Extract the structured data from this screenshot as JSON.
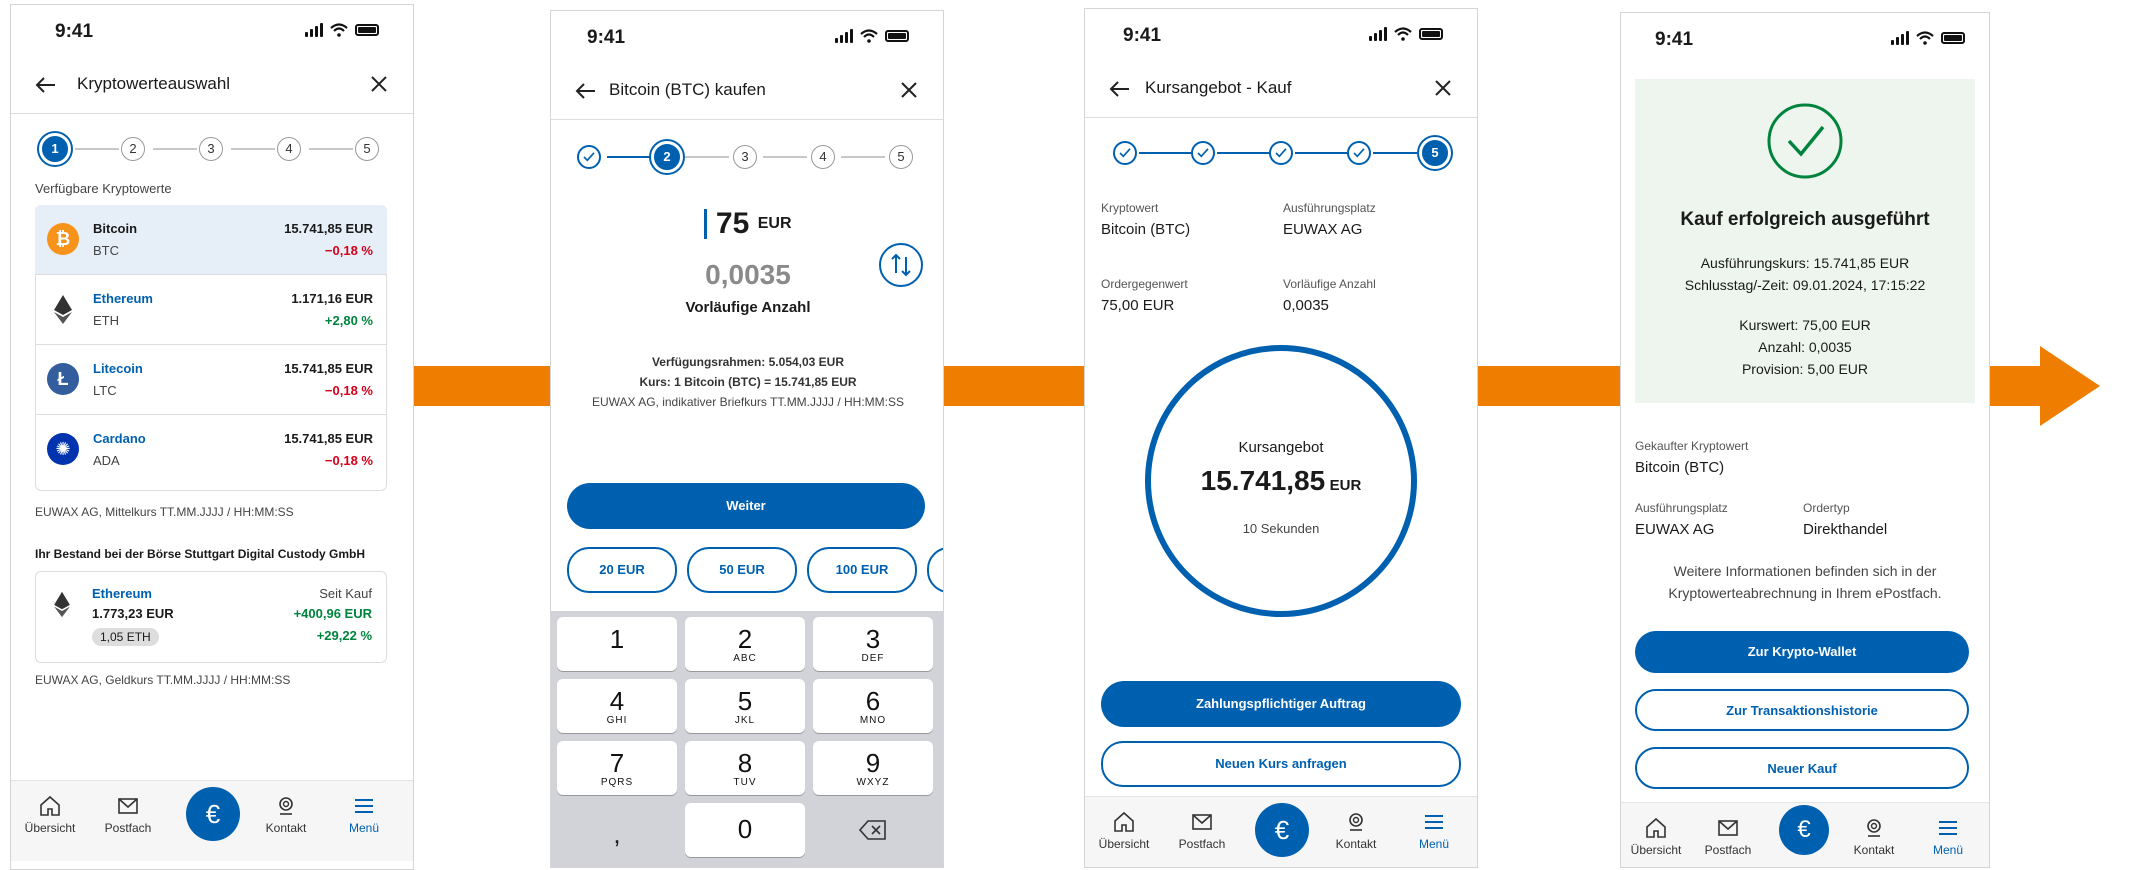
{
  "status_time": "9:41",
  "nav": {
    "uebersicht": "Übersicht",
    "postfach": "Postfach",
    "euro": "€",
    "kontakt": "Kontakt",
    "menue": "Menü"
  },
  "screen1": {
    "title": "Kryptowerteauswahl",
    "steps": [
      "1",
      "2",
      "3",
      "4",
      "5"
    ],
    "section_label": "Verfügbare Kryptowerte",
    "cryptos": [
      {
        "name": "Bitcoin",
        "symbol": "BTC",
        "price": "15.741,85 EUR",
        "change": "−0,18 %"
      },
      {
        "name": "Ethereum",
        "symbol": "ETH",
        "price": "1.171,16 EUR",
        "change": "+2,80 %"
      },
      {
        "name": "Litecoin",
        "symbol": "LTC",
        "price": "15.741,85 EUR",
        "change": "−0,18 %"
      },
      {
        "name": "Cardano",
        "symbol": "ADA",
        "price": "15.741,85 EUR",
        "change": "−0,18 %"
      }
    ],
    "mittelkurs_note": "EUWAX AG, Mittelkurs TT.MM.JJJJ / HH:MM:SS",
    "holding_heading": "Ihr Bestand bei der Börse Stuttgart Digital Custody GmbH",
    "holding": {
      "name": "Ethereum",
      "value": "1.773,23 EUR",
      "amount": "1,05 ETH",
      "since_label": "Seit Kauf",
      "gain_abs": "+400,96 EUR",
      "gain_pct": "+29,22 %"
    },
    "geldkurs_note": "EUWAX AG, Geldkurs TT.MM.JJJJ / HH:MM:SS"
  },
  "screen2": {
    "title": "Bitcoin (BTC) kaufen",
    "steps": [
      "2",
      "3",
      "4",
      "5"
    ],
    "amount": "75",
    "currency": "EUR",
    "crypto_amount": "0,0035",
    "crypto_label": "Vorläufige Anzahl",
    "info1": "Verfügungsrahmen: 5.054,03 EUR",
    "info2": "Kurs: 1 Bitcoin (BTC) = 15.741,85 EUR",
    "info3": "EUWAX AG, indikativer Briefkurs TT.MM.JJJJ / HH:MM:SS",
    "next_button": "Weiter",
    "chips": [
      "20 EUR",
      "50 EUR",
      "100 EUR"
    ],
    "keys": [
      {
        "n": "1",
        "l": ""
      },
      {
        "n": "2",
        "l": "ABC"
      },
      {
        "n": "3",
        "l": "DEF"
      },
      {
        "n": "4",
        "l": "GHI"
      },
      {
        "n": "5",
        "l": "JKL"
      },
      {
        "n": "6",
        "l": "MNO"
      },
      {
        "n": "7",
        "l": "PQRS"
      },
      {
        "n": "8",
        "l": "TUV"
      },
      {
        "n": "9",
        "l": "WXYZ"
      }
    ],
    "key_comma": ",",
    "key_zero": "0"
  },
  "screen3": {
    "title": "Kursangebot - Kauf",
    "active_step": "5",
    "crypto_label": "Kryptowert",
    "crypto_value": "Bitcoin (BTC)",
    "venue_label": "Ausführungsplatz",
    "venue_value": "EUWAX AG",
    "order_label": "Ordergegenwert",
    "order_value": "75,00 EUR",
    "qty_label": "Vorläufige Anzahl",
    "qty_value": "0,0035",
    "offer_label": "Kursangebot",
    "offer_value": "15.741,85",
    "offer_currency": "EUR",
    "countdown": "10 Sekunden",
    "pay_button": "Zahlungspflichtiger Auftrag",
    "new_rate_button": "Neuen Kurs anfragen"
  },
  "screen4": {
    "success_title": "Kauf erfolgreich ausgeführt",
    "rate_line": "Ausführungskurs: 15.741,85 EUR",
    "time_line": "Schlusstag/-Zeit: 09.01.2024, 17:15:22",
    "kurswert": "Kurswert: 75,00 EUR",
    "anzahl": "Anzahl: 0,0035",
    "provision": "Provision: 5,00 EUR",
    "bought_label": "Gekaufter Kryptowert",
    "bought_value": "Bitcoin (BTC)",
    "venue_label": "Ausführungsplatz",
    "venue_value": "EUWAX AG",
    "ordertype_label": "Ordertyp",
    "ordertype_value": "Direkthandel",
    "info_text1": "Weitere Informationen befinden sich in der",
    "info_text2": "Kryptowerteabrechnung in Ihrem ePostfach.",
    "wallet_button": "Zur Krypto-Wallet",
    "history_button": "Zur Transaktionshistorie",
    "new_purchase_button": "Neuer Kauf"
  },
  "colors": {
    "accent": "#0060b0",
    "arrow": "#ef7d00",
    "negative": "#d4001a",
    "positive": "#00843d",
    "success_bg": "#eef5ee"
  }
}
